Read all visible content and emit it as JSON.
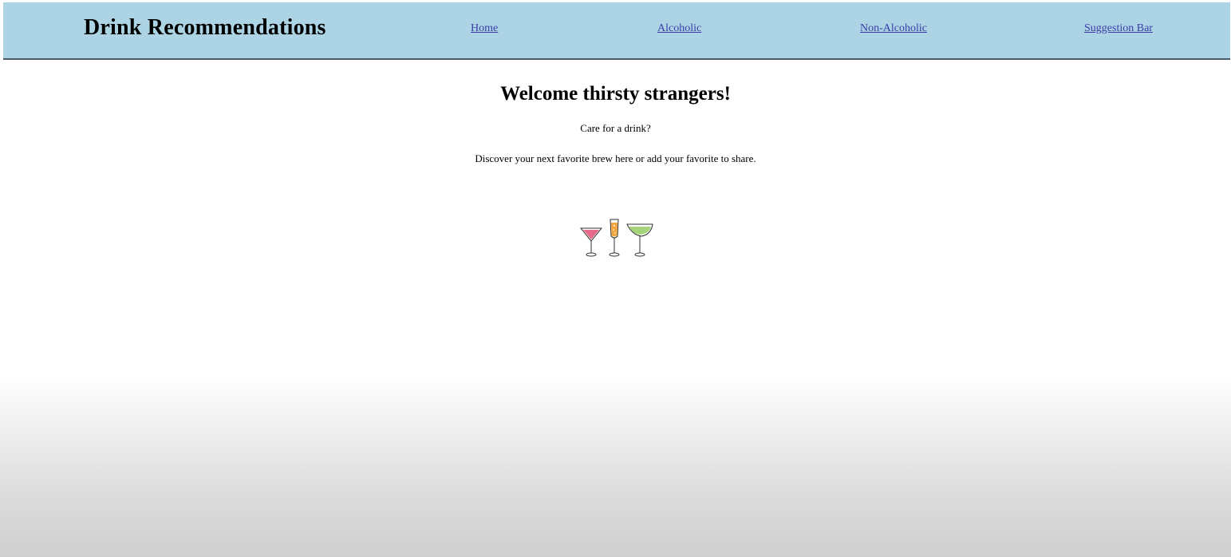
{
  "header": {
    "title": "Drink Recommendations",
    "nav": [
      {
        "label": "Home"
      },
      {
        "label": "Alcoholic"
      },
      {
        "label": "Non-Alcoholic"
      },
      {
        "label": "Suggestion Bar"
      }
    ],
    "background_color": "#acd4e4",
    "link_color": "#3b3ba8"
  },
  "main": {
    "heading": "Welcome thirsty strangers!",
    "tagline": "Care for a drink?",
    "description": "Discover your next favorite brew here or add your favorite to share.",
    "illustration_icons": [
      "cocktail-glass-pink-icon",
      "champagne-flute-icon",
      "margarita-glass-green-icon"
    ]
  }
}
